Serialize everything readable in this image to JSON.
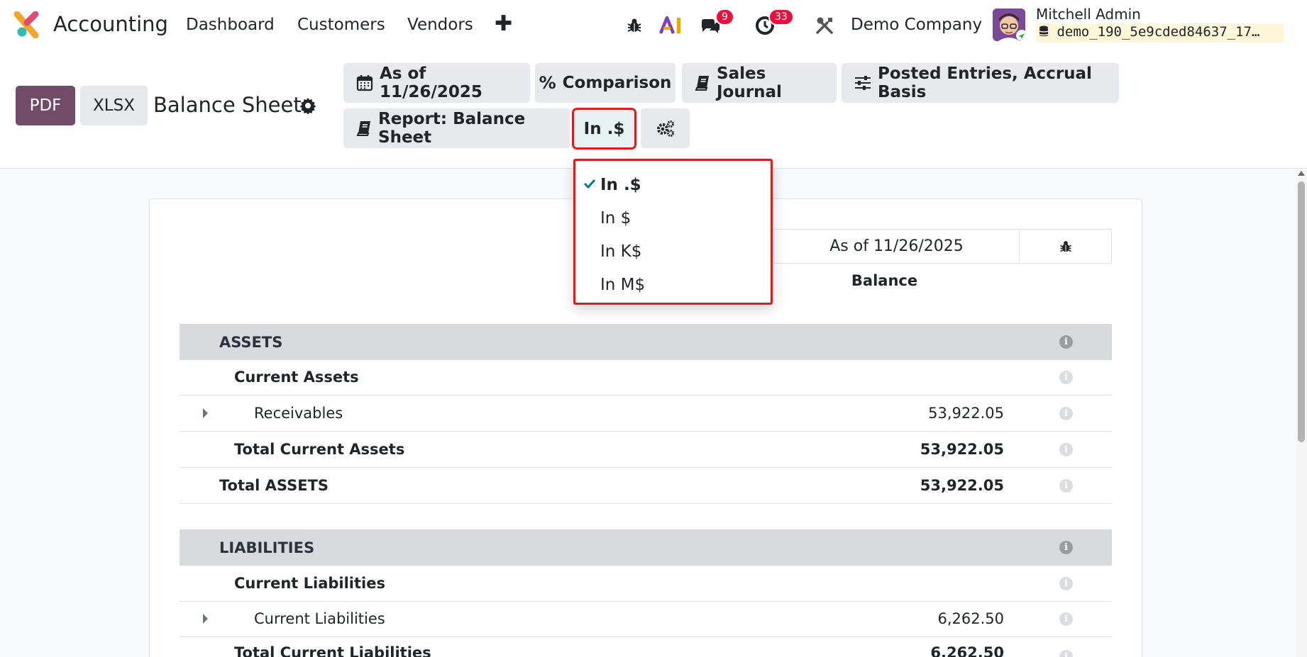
{
  "navbar": {
    "app_name": "Accounting",
    "menus": [
      "Dashboard",
      "Customers",
      "Vendors"
    ],
    "plus_label": "✚",
    "messages_count": "9",
    "activities_count": "33",
    "company": "Demo Company",
    "user_name": "Mitchell Admin",
    "database": "demo_190_5e9cded84637_17…"
  },
  "control_panel": {
    "pdf_label": "PDF",
    "xlsx_label": "XLSX",
    "title": "Balance Sheet",
    "filters": {
      "date": "As of 11/26/2025",
      "comparison": "Comparison",
      "journal": "Sales Journal",
      "options": "Posted Entries, Accrual Basis",
      "report": "Report: Balance Sheet",
      "rounding": "In .$"
    }
  },
  "dropdown": {
    "items": [
      {
        "label": "In .$",
        "selected": true
      },
      {
        "label": "In $",
        "selected": false
      },
      {
        "label": "In K$",
        "selected": false
      },
      {
        "label": "In M$",
        "selected": false
      }
    ]
  },
  "report": {
    "column_header": "As of 11/26/2025",
    "column_sub": "Balance",
    "rows": [
      {
        "label": "ASSETS",
        "amount": "",
        "type": "section"
      },
      {
        "label": "Current Assets",
        "amount": "",
        "type": "group"
      },
      {
        "label": "Receivables",
        "amount": "53,922.05",
        "type": "line"
      },
      {
        "label": "Total Current Assets",
        "amount": "53,922.05",
        "type": "total"
      },
      {
        "label": "Total ASSETS",
        "amount": "53,922.05",
        "type": "grand"
      },
      {
        "label": "LIABILITIES",
        "amount": "",
        "type": "section"
      },
      {
        "label": "Current Liabilities",
        "amount": "",
        "type": "group"
      },
      {
        "label": "Current Liabilities",
        "amount": "6,262.50",
        "type": "line"
      },
      {
        "label": "Total Current Liabilities",
        "amount": "6,262.50",
        "type": "total"
      }
    ]
  },
  "colors": {
    "brand": "#714b67",
    "badge": "#e8113d",
    "highlight": "#e01b1b",
    "check": "#017e84"
  }
}
